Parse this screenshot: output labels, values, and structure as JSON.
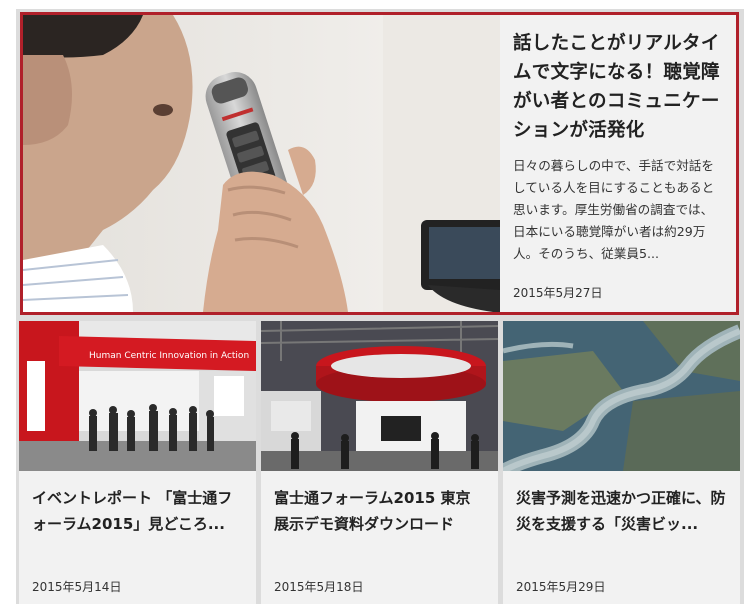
{
  "featured": {
    "title": "話したことがリアルタイムで文字になる！聴覚障がい者とのコミュニケーションが活発化",
    "excerpt": "日々の暮らしの中で、手話で対話をしている人を目にすることもあると思います。厚生労働省の調査では、日本にいる聴覚障がい者は約29万人。そのうち、従業員5...",
    "date": "2015年5月27日"
  },
  "cards": [
    {
      "title": "イベントレポート 「富士通フォーラム2015」見どころ...",
      "date": "2015年5月14日",
      "image_text": "Human Centric Innovation in Action"
    },
    {
      "title": "富士通フォーラム2015 東京 展示デモ資料ダウンロード",
      "date": "2015年5月18日"
    },
    {
      "title": "災害予測を迅速かつ正確に、防災を支援する「災害ビッ...",
      "date": "2015年5月29日"
    }
  ],
  "colors": {
    "accent_border": "#b0202a",
    "card_bg": "#f2f2f2",
    "grid_bg": "#dcdcdc"
  }
}
